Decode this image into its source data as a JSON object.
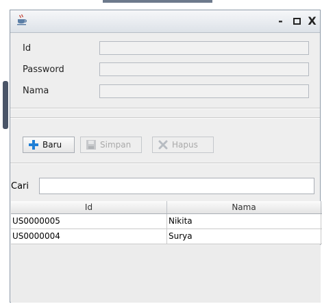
{
  "window": {
    "icon": "java-cup-icon",
    "controls": {
      "minimize": "-",
      "close": "X"
    }
  },
  "form": {
    "fields": [
      {
        "label": "Id",
        "value": ""
      },
      {
        "label": "Password",
        "value": ""
      },
      {
        "label": "Nama",
        "value": ""
      }
    ]
  },
  "toolbar": {
    "buttons": [
      {
        "label": "Baru",
        "icon": "plus-icon",
        "enabled": true
      },
      {
        "label": "Simpan",
        "icon": "save-icon",
        "enabled": false
      },
      {
        "label": "Hapus",
        "icon": "delete-x-icon",
        "enabled": false
      }
    ]
  },
  "search": {
    "label": "Cari",
    "value": ""
  },
  "table": {
    "columns": [
      "Id",
      "Nama"
    ],
    "rows": [
      [
        "US0000005",
        "Nikita"
      ],
      [
        "US0000004",
        "Surya"
      ]
    ]
  },
  "colors": {
    "plus": "#1f7fd6",
    "window_bg": "#eeeeee",
    "titlebar": "#dde2e8"
  }
}
